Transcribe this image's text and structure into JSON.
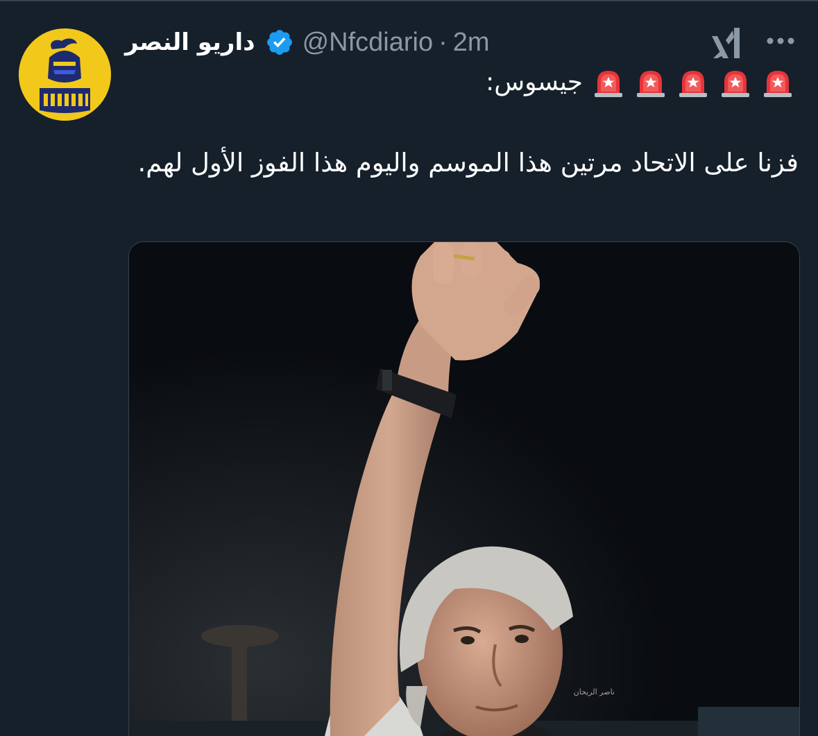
{
  "tweet": {
    "display_name": "داريو النصر",
    "handle": "@Nfcdiario",
    "separator": "·",
    "time": "2m",
    "line1_text": "جيسوس:",
    "body_text": "فزنا على الاتحاد مرتين هذا الموسم واليوم هذا الفوز الأول لهم."
  },
  "icons": {
    "avatar": "knight-helmet-diario-logo",
    "verified": "verified-badge-icon",
    "grok": "grok-icon",
    "more": "more-icon",
    "alarm": "police-siren-emoji",
    "alarm_count": 5
  },
  "media": {
    "watermark": "ناصر الريحان"
  },
  "colors": {
    "background": "#15202b",
    "secondary_text": "#8b98a5",
    "verified_blue": "#1d9bf0",
    "avatar_yellow": "#f2c81b",
    "avatar_navy": "#1e2a6e"
  }
}
